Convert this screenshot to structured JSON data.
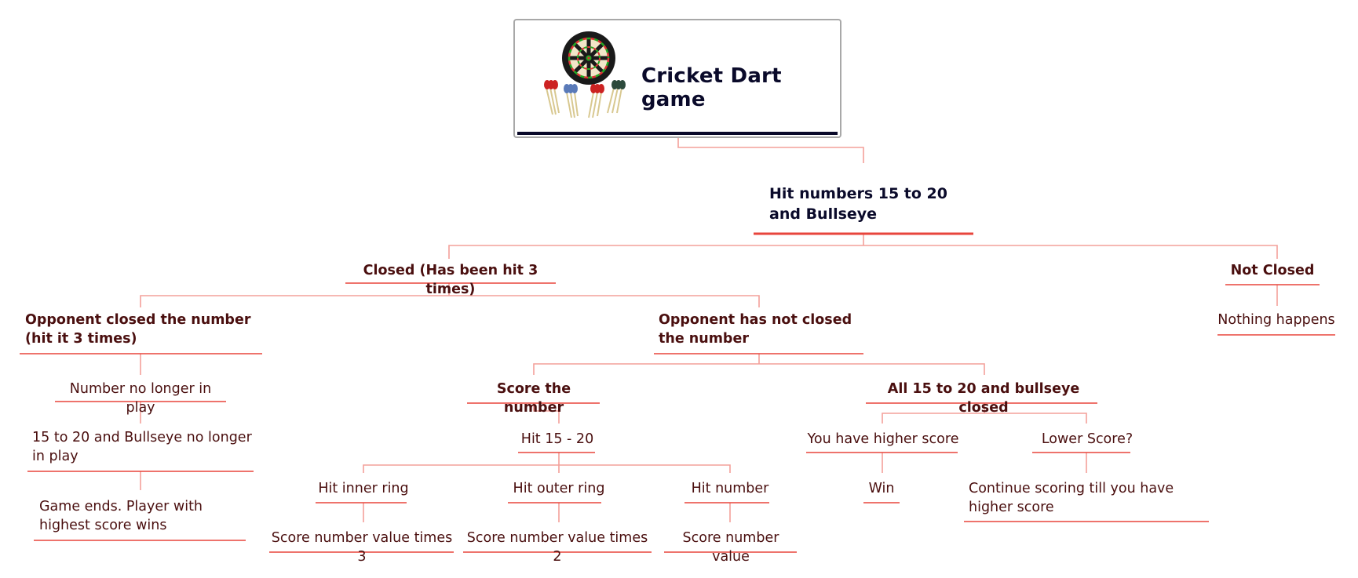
{
  "root": {
    "title": "Cricket Dart game",
    "image": "dartboard-with-darts"
  },
  "colors": {
    "connector": "#f4a09a",
    "underline": "#e8453c",
    "node_text": "#4a0f0f",
    "root_text": "#0a0a2a"
  },
  "nodes": {
    "hit_numbers": "Hit numbers 15 to 20 and Bullseye",
    "closed": "Closed (Has been hit 3 times)",
    "not_closed": "Not Closed",
    "nothing_happens": "Nothing happens",
    "opp_closed": "Opponent closed the number (hit it 3 times)",
    "number_no_longer": "Number no longer in play",
    "all_no_longer": "15 to 20 and Bullseye no longer in play",
    "game_ends": "Game ends. Player with highest score wins",
    "opp_not_closed": "Opponent has not closed the number",
    "score_number": "Score the number",
    "hit_15_20": "Hit 15 - 20",
    "hit_inner": "Hit inner ring",
    "score_x3": "Score number value times 3",
    "hit_outer": "Hit outer ring",
    "score_x2": "Score number value times 2",
    "hit_number": "Hit number",
    "score_value": "Score number value",
    "all_closed": "All 15 to 20 and bullseye closed",
    "higher_score": "You have higher score",
    "win": "Win",
    "lower_score": "Lower Score?",
    "continue_scoring": "Continue scoring till you have higher score"
  }
}
